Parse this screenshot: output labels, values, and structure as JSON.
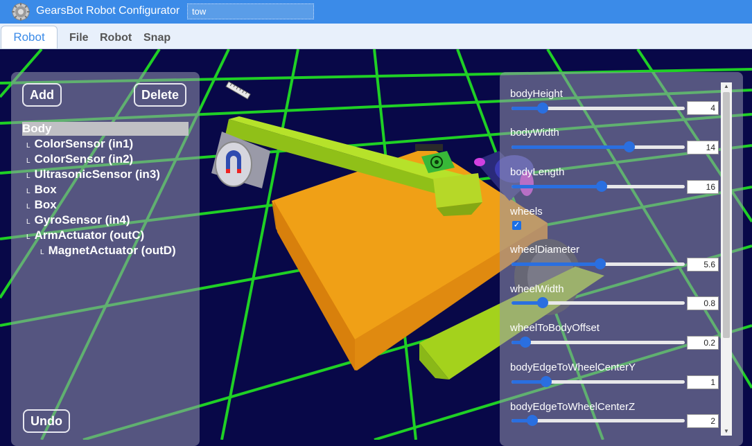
{
  "app": {
    "title": "GearsBot Robot Configurator",
    "robot_name": "tow",
    "accent_color": "#3b8be8"
  },
  "menu": {
    "active_tab": "Robot",
    "items": [
      "File",
      "Robot",
      "Snap"
    ]
  },
  "left_panel": {
    "add_label": "Add",
    "delete_label": "Delete",
    "undo_label": "Undo",
    "selected": "Body",
    "tree": [
      {
        "label": "ColorSensor (in1)"
      },
      {
        "label": "ColorSensor (in2)"
      },
      {
        "label": "UltrasonicSensor (in3)"
      },
      {
        "label": "Box"
      },
      {
        "label": "Box"
      },
      {
        "label": "GyroSensor (in4)"
      },
      {
        "label": "ArmActuator (outC)"
      },
      {
        "label": "MagnetActuator (outD)"
      }
    ],
    "tree_marker": "L"
  },
  "properties": [
    {
      "name": "bodyHeight",
      "value": "4",
      "level": 0.18
    },
    {
      "name": "bodyWidth",
      "value": "14",
      "level": 0.68
    },
    {
      "name": "bodyLength",
      "value": "16",
      "level": 0.52
    },
    {
      "name": "wheels",
      "checked": true
    },
    {
      "name": "wheelDiameter",
      "value": "5.6",
      "level": 0.51
    },
    {
      "name": "wheelWidth",
      "value": "0.8",
      "level": 0.18
    },
    {
      "name": "wheelToBodyOffset",
      "value": "0.2",
      "level": 0.08
    },
    {
      "name": "bodyEdgeToWheelCenterY",
      "value": "1",
      "level": 0.2
    },
    {
      "name": "bodyEdgeToWheelCenterZ",
      "value": "2",
      "level": 0.12
    }
  ],
  "scene": {
    "grid_color": "#22e622",
    "background_color": "#080848",
    "body_color": "#e8920e",
    "arm_color": "#a4d21c"
  },
  "icons": {
    "logo": "gear-icon",
    "ruler": "ruler-icon",
    "magnet": "magnet-icon",
    "gyro": "gyro-icon",
    "ultrasonic": "ultrasonic-icon"
  }
}
